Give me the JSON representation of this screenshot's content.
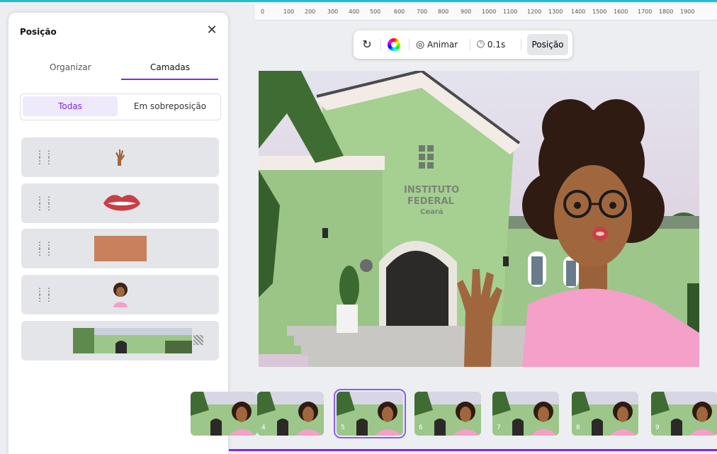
{
  "panel": {
    "title": "Posição",
    "close_icon": "close-icon",
    "tabs": [
      {
        "label": "Organizar"
      },
      {
        "label": "Camadas"
      }
    ],
    "active_tab": "Camadas",
    "filter": {
      "options": [
        {
          "label": "Todas"
        },
        {
          "label": "Em sobreposição"
        }
      ],
      "selected": "Todas"
    },
    "layers": [
      {
        "icon": "hand-icon"
      },
      {
        "icon": "lips-icon"
      },
      {
        "icon": "rectangle-icon"
      },
      {
        "icon": "woman-avatar-icon"
      },
      {
        "icon": "background-photo-icon"
      }
    ]
  },
  "ruler": {
    "ticks": [
      "0",
      "100",
      "200",
      "300",
      "400",
      "500",
      "600",
      "700",
      "800",
      "900",
      "1000",
      "1100",
      "1200",
      "1300",
      "1400",
      "1500",
      "1600",
      "1700",
      "1800",
      "1900"
    ]
  },
  "toolbar": {
    "rotate_icon": "rotate-icon",
    "color_icon": "color-wheel-icon",
    "animate_label": "Animar",
    "duration_label": "0.1s",
    "position_label": "Posição"
  },
  "canvas": {
    "building_sign_line1": "INSTITUTO",
    "building_sign_line2": "FEDERAL",
    "building_sign_line3": "Ceará"
  },
  "timeline": {
    "pages": [
      {
        "number": ""
      },
      {
        "number": "4"
      },
      {
        "number": "5",
        "selected": true
      },
      {
        "number": "6"
      },
      {
        "number": "7"
      },
      {
        "number": "8"
      },
      {
        "number": "9"
      }
    ]
  },
  "colors": {
    "accent": "#7d2ae8",
    "teal": "#27bcc7",
    "building": "#9dc68a",
    "skin": "#a0673f",
    "shirt": "#f4a0c8"
  }
}
